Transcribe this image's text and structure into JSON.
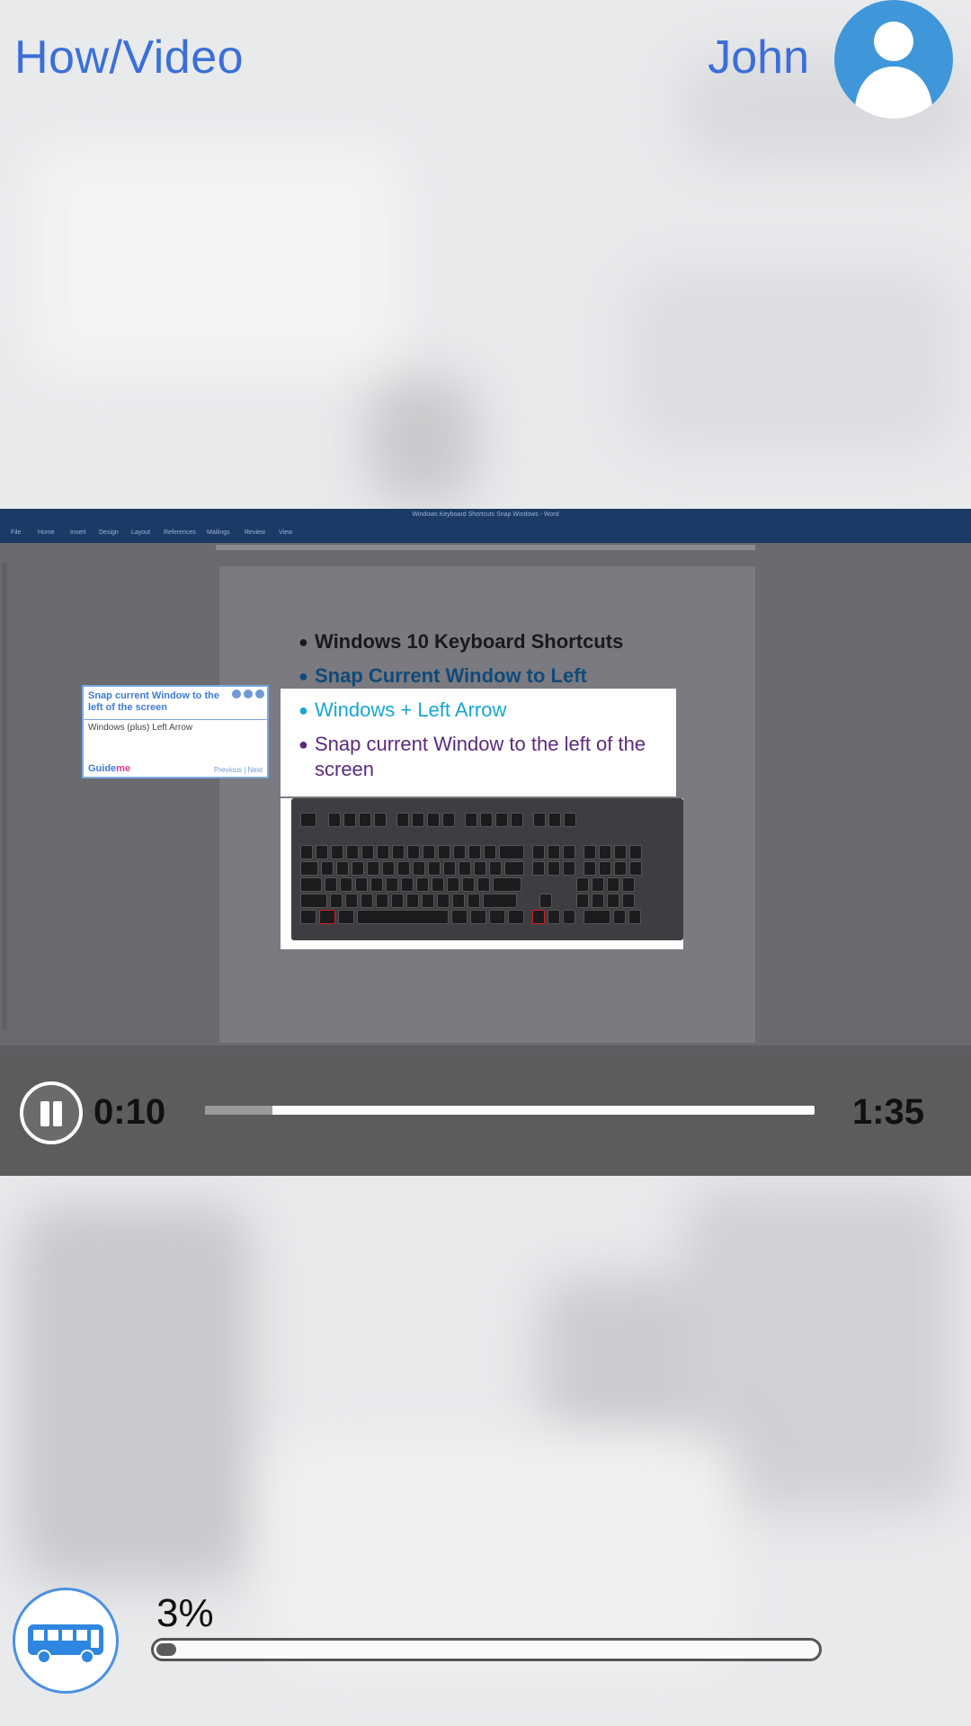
{
  "header": {
    "app_title": "How/Video",
    "user_name": "John",
    "avatar_icon": "user-avatar-icon"
  },
  "video_frame": {
    "word_title": "Windows Keyboard Shortcuts Snap Windows - Word",
    "word_menu": [
      "File",
      "Home",
      "Insert",
      "Design",
      "Layout",
      "References",
      "Mailings",
      "Review",
      "View"
    ],
    "doc_lines": [
      "Windows 10 Keyboard Shortcuts",
      "Snap Current Window to Left",
      "Windows + Left Arrow",
      "Snap current Window to the left of the screen"
    ],
    "tooltip": {
      "title": "Snap current Window to the left of the screen",
      "body": "Windows (plus) Left Arrow",
      "logo_a": "Guide",
      "logo_b": "me",
      "nav": "Previous | Next"
    }
  },
  "player": {
    "pause_icon": "pause-icon",
    "current_time": "0:10",
    "total_time": "1:35",
    "seek_fraction": 0.11
  },
  "download": {
    "icon": "bus-icon",
    "percent_label": "3%",
    "percent_value": 0.03
  },
  "colors": {
    "accent": "#3a6fd8",
    "avatar_bg": "#3f97d9",
    "controls_bg": "#5c5c5e"
  }
}
